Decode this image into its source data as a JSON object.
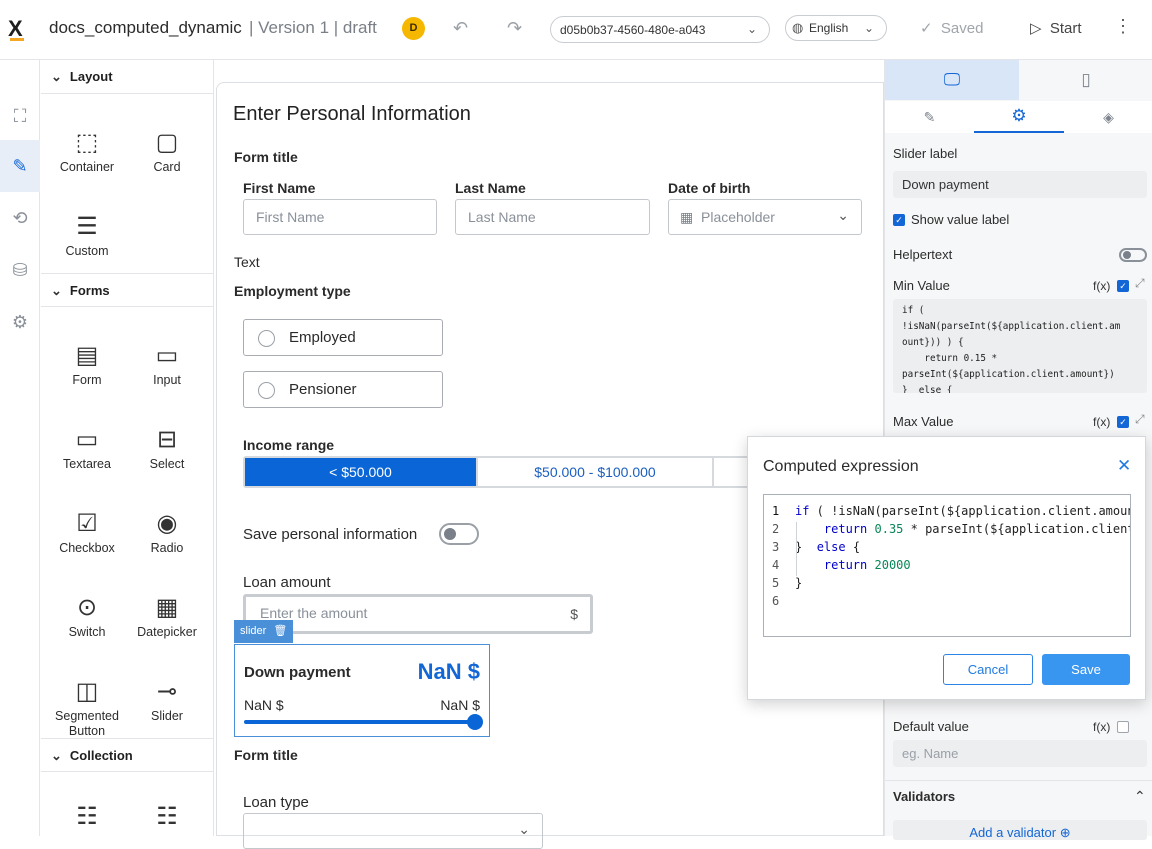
{
  "header": {
    "logo": "X",
    "title": "docs_computed_dynamic",
    "meta": "| Version 1 | draft",
    "avatar_initial": "D",
    "session_id": "d05b0b37-4560-480e-a043",
    "language": "English",
    "saved_label": "Saved",
    "start_label": "Start"
  },
  "palette": {
    "sections": [
      {
        "title": "Layout"
      },
      {
        "title": "Forms"
      },
      {
        "title": "Collection"
      }
    ],
    "layout_items": [
      "Container",
      "Card",
      "Custom"
    ],
    "form_items": [
      "Form",
      "Input",
      "Textarea",
      "Select",
      "Checkbox",
      "Radio",
      "Switch",
      "Datepicker",
      "Segmented\nButton",
      "Slider"
    ]
  },
  "canvas": {
    "card_title": "Enter Personal Information",
    "form_title_1": "Form title",
    "first_name_label": "First Name",
    "first_name_placeholder": "First Name",
    "last_name_label": "Last Name",
    "last_name_placeholder": "Last Name",
    "dob_label": "Date of birth",
    "dob_placeholder": "Placeholder",
    "text_label": "Text",
    "employment_label": "Employment type",
    "employment_options": [
      "Employed",
      "Pensioner"
    ],
    "income_label": "Income range",
    "income_options": [
      "< $50.000",
      "$50.000 - $100.000"
    ],
    "save_info_label": "Save personal information",
    "loan_amount_label": "Loan amount",
    "loan_amount_placeholder": "Enter the amount",
    "loan_amount_unit": "$",
    "slider_tag": "slider",
    "slider_label": "Down payment",
    "slider_value": "NaN $",
    "slider_min": "NaN $",
    "slider_max": "NaN $",
    "form_title_2": "Form title",
    "loan_type_label": "Loan type"
  },
  "properties": {
    "slider_label_caption": "Slider label",
    "slider_label_value": "Down payment",
    "show_value_label": "Show value label",
    "helpertext": "Helpertext",
    "min_value": "Min Value",
    "fx": "f(x)",
    "min_code": "if (\n!isNaN(parseInt(${application.client.am\nount})) ) {\n    return 0.15 *\nparseInt(${application.client.amount})\n}  else {",
    "max_value": "Max Value",
    "default_value": "Default value",
    "default_placeholder": "eg. Name",
    "validators": "Validators",
    "add_validator": "Add a validator"
  },
  "modal": {
    "title": "Computed expression",
    "line_numbers": [
      "1",
      "2",
      "3",
      "4",
      "5",
      "6"
    ],
    "cancel": "Cancel",
    "save": "Save"
  },
  "colors": {
    "accent": "#1366d6",
    "save_button": "#3996f0",
    "segment_active": "#0a66d6"
  }
}
